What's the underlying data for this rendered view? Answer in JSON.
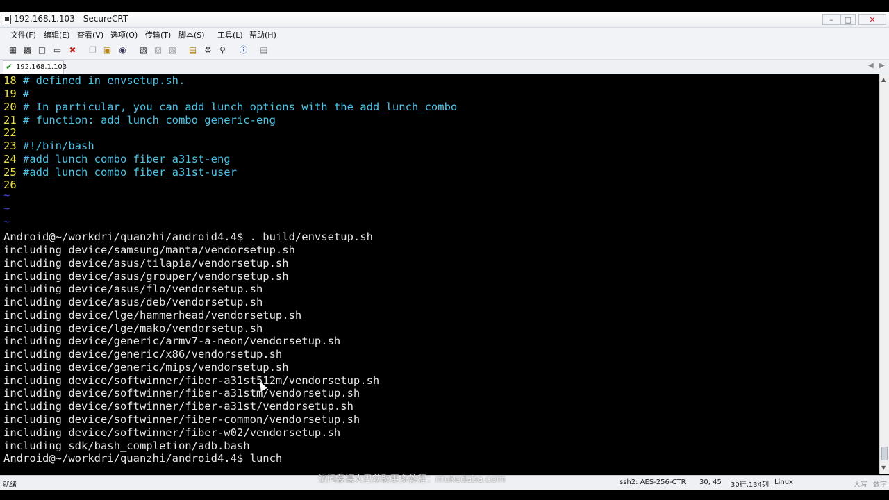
{
  "window": {
    "title": "192.168.1.103 - SecureCRT",
    "buttons": [
      "–",
      "□",
      "✕"
    ]
  },
  "menu": [
    "文件(F)",
    "编辑(E)",
    "查看(V)",
    "选项(O)",
    "传输(T)",
    "脚本(S)",
    "工具(L)",
    "帮助(H)"
  ],
  "toolbar_icons": [
    "connect-icon",
    "quick-connect-icon",
    "connect-tab-icon",
    "reconnect-icon",
    "disconnect-icon",
    "copy-icon",
    "paste-icon",
    "find-icon",
    "print-icon",
    "print-setup-icon",
    "print-selection-icon",
    "session-options-icon",
    "global-options-icon",
    "keymap-icon",
    "help-icon",
    "lock-icon"
  ],
  "tab": {
    "label": "192.168.1.103"
  },
  "editor_lines": [
    {
      "num": "18",
      "text": "# defined in envsetup.sh."
    },
    {
      "num": "19",
      "text": "#"
    },
    {
      "num": "20",
      "text": "# In particular, you can add lunch options with the add_lunch_combo"
    },
    {
      "num": "21",
      "text": "# function: add_lunch_combo generic-eng"
    },
    {
      "num": "22",
      "text": ""
    },
    {
      "num": "23",
      "text": "#!/bin/bash"
    },
    {
      "num": "24",
      "text": "#add_lunch_combo fiber_a31st-eng"
    },
    {
      "num": "25",
      "text": "#add_lunch_combo fiber_a31st-user"
    },
    {
      "num": "26",
      "text": ""
    }
  ],
  "tilde_lines": [
    "~",
    "~",
    "~"
  ],
  "output_lines": [
    "Android@~/workdri/quanzhi/android4.4$ . build/envsetup.sh",
    "including device/samsung/manta/vendorsetup.sh",
    "including device/asus/tilapia/vendorsetup.sh",
    "including device/asus/grouper/vendorsetup.sh",
    "including device/asus/flo/vendorsetup.sh",
    "including device/asus/deb/vendorsetup.sh",
    "including device/lge/hammerhead/vendorsetup.sh",
    "including device/lge/mako/vendorsetup.sh",
    "including device/generic/armv7-a-neon/vendorsetup.sh",
    "including device/generic/x86/vendorsetup.sh",
    "including device/generic/mips/vendorsetup.sh",
    "including device/softwinner/fiber-a31st512m/vendorsetup.sh",
    "including device/softwinner/fiber-a31stm/vendorsetup.sh",
    "including device/softwinner/fiber-a31st/vendorsetup.sh",
    "including device/softwinner/fiber-common/vendorsetup.sh",
    "including device/softwinner/fiber-w02/vendorsetup.sh",
    "including sdk/bash_completion/adb.bash",
    "Android@~/workdri/quanzhi/android4.4$ lunch"
  ],
  "status": {
    "ready": "就绪",
    "cipher": "ssh2: AES-256-CTR",
    "position": "30, 45",
    "size": "30行,134列",
    "os": "Linux",
    "caps": "大写",
    "num": "数字"
  },
  "watermark": "访问慕课大巴获取更多教程：mukedaba.com"
}
